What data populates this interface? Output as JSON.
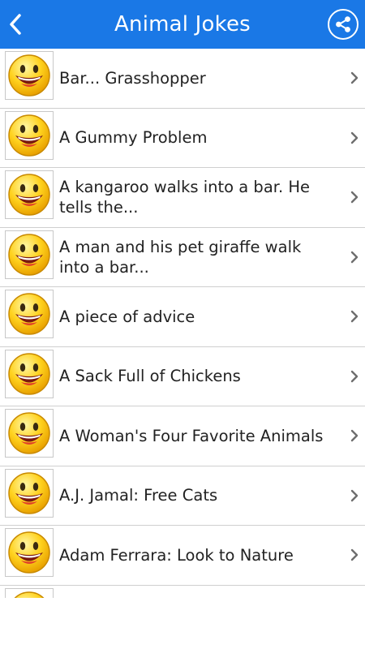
{
  "header": {
    "title": "Animal Jokes",
    "back_icon": "chevron-left-icon",
    "share_icon": "share-icon",
    "color": "#1a78e6"
  },
  "jokes": [
    {
      "title": "Bar... Grasshopper"
    },
    {
      "title": "A Gummy Problem"
    },
    {
      "title": "A kangaroo walks into a bar. He tells the..."
    },
    {
      "title": "A man and his pet giraffe walk into a bar..."
    },
    {
      "title": "A piece of advice"
    },
    {
      "title": "A Sack Full of Chickens"
    },
    {
      "title": "A Woman's Four Favorite Animals"
    },
    {
      "title": "A.J. Jamal: Free Cats"
    },
    {
      "title": "Adam Ferrara: Look to Nature"
    },
    {
      "title": ""
    }
  ],
  "icons": {
    "thumbnail": "smiley-face-icon",
    "row_arrow": "chevron-right-icon"
  }
}
